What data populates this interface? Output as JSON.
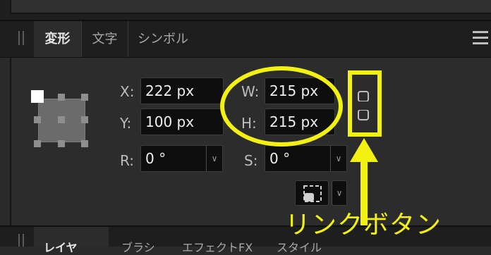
{
  "tabs": [
    {
      "label": "変形",
      "active": true
    },
    {
      "label": "文字",
      "active": false
    },
    {
      "label": "シンボル",
      "active": false
    }
  ],
  "transform": {
    "x_label": "X:",
    "x_value": "222 px",
    "y_label": "Y:",
    "y_value": "100 px",
    "w_label": "W:",
    "w_value": "215 px",
    "h_label": "H:",
    "h_value": "215 px",
    "r_label": "R:",
    "r_value": "0 °",
    "s_label": "S:",
    "s_value": "0 °"
  },
  "annotation": {
    "text": "リンクボタン",
    "color": "#f2f10f"
  },
  "bottom_tabs": [
    "レイヤ",
    "ブラシ",
    "エフェクトFX",
    "スタイル"
  ],
  "icons": {
    "menu": "hamburger-menu-icon",
    "link": "link-chain-icon",
    "transform_origin": "transform-origin-icon"
  }
}
